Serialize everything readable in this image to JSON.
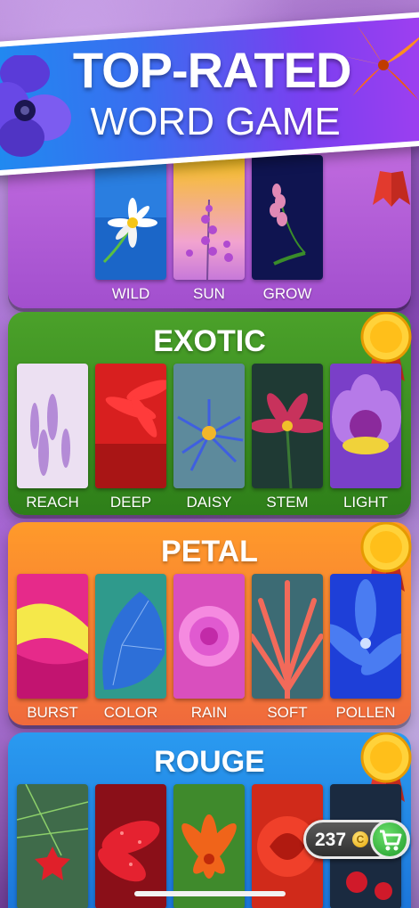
{
  "banner": {
    "line1": "TOP-RATED",
    "line2": "WORD GAME"
  },
  "packs": [
    {
      "id": "purple",
      "title": "",
      "color": "#b35bd8",
      "tiles": [
        {
          "label": "WILD",
          "art": "daisy-on-blue"
        },
        {
          "label": "SUN",
          "art": "lavender-on-yellow"
        },
        {
          "label": "GROW",
          "art": "pink-spike-on-navy"
        }
      ]
    },
    {
      "id": "exotic",
      "title": "EXOTIC",
      "color": "#3b8f22",
      "tiles": [
        {
          "label": "REACH",
          "art": "lavender-field"
        },
        {
          "label": "DEEP",
          "art": "red-gerbera"
        },
        {
          "label": "DAISY",
          "art": "blue-aster"
        },
        {
          "label": "STEM",
          "art": "lily-on-dark"
        },
        {
          "label": "LIGHT",
          "art": "purple-lotus"
        }
      ]
    },
    {
      "id": "petal",
      "title": "PETAL",
      "color": "#f7803a",
      "tiles": [
        {
          "label": "BURST",
          "art": "pink-yellow-petals"
        },
        {
          "label": "COLOR",
          "art": "blue-morning-glory"
        },
        {
          "label": "RAIN",
          "art": "pink-dahlia"
        },
        {
          "label": "SOFT",
          "art": "red-succulent"
        },
        {
          "label": "POLLEN",
          "art": "blue-petals-dew"
        }
      ]
    },
    {
      "id": "rouge",
      "title": "ROUGE",
      "color": "#2383e4",
      "tiles": [
        {
          "label": "",
          "art": "red-star-flower"
        },
        {
          "label": "",
          "art": "red-dew-petals"
        },
        {
          "label": "",
          "art": "orange-lily"
        },
        {
          "label": "",
          "art": "red-rose"
        },
        {
          "label": "",
          "art": "red-blossoms"
        }
      ]
    }
  ],
  "wallet": {
    "coins": "237",
    "coin_symbol": "C",
    "cart_icon": "cart-icon"
  },
  "colors": {
    "gold": "#ffc629",
    "ribbon": "#e23a2e"
  }
}
